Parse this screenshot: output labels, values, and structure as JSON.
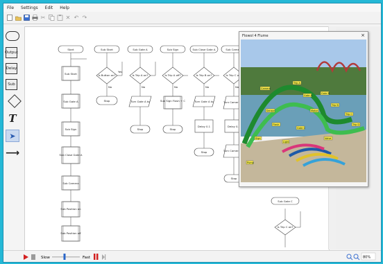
{
  "menu": [
    "File",
    "Settings",
    "Edit",
    "Help"
  ],
  "toolbar_icons": [
    "new-icon",
    "open-icon",
    "save-icon",
    "print-icon",
    "cut-icon",
    "copy-icon",
    "paste-icon",
    "delete-icon",
    "undo-icon",
    "redo-icon"
  ],
  "palette": {
    "output": "Output",
    "delay": "Delay",
    "sub": "Sub",
    "text": "T"
  },
  "flowchart": {
    "start": "Start",
    "start_steps": [
      "Sub Start",
      "Sub Gate A",
      "Sub Sign",
      "Sub Close Gate A",
      "Sub Camera",
      "Sub Position on",
      "Sub Position off"
    ],
    "subs": [
      "Sub Start",
      "Sub Gate A",
      "Sub Sign",
      "Sub Close Gate A",
      "Sub Camera"
    ],
    "decisions": [
      "Is Button on?",
      "Is Trip A on?",
      "Is Trip A off?",
      "Is Trip B on?",
      "Is Trip C on?"
    ],
    "yes": "Yes",
    "no": "No",
    "actions": [
      "Stop",
      "Turn Gate A to",
      "Sub Sign Flash + C",
      "Turn Gate A to",
      "Turn Camera on"
    ],
    "stops": [
      "Stop",
      "Stop",
      "Stop",
      "Stop",
      "Stop"
    ],
    "delay": "Delay 0.1",
    "delay2": "Delay 0.5",
    "camera_off": "Turn Camera off",
    "sub_gate_c": "Sub Gate C",
    "is_trip_c": "Is Trip C on?"
  },
  "popup": {
    "title": "Flowol 4 Flume",
    "close": "×",
    "labels": [
      "Camera",
      "Trip A",
      "Gate A",
      "Trip B",
      "Trip C",
      "Flash",
      "Gate C",
      "Sign",
      "Light",
      "Pump",
      "Motor",
      "Gate B",
      "Trip D",
      "Sensor",
      "Valve"
    ]
  },
  "status": {
    "slow": "Slow",
    "fast": "Fast",
    "zoom": "80%",
    "speed_fraction": 0.45,
    "colors": {
      "run": "#d32020",
      "pause": "#d32020",
      "accent": "#25b8d6"
    }
  }
}
